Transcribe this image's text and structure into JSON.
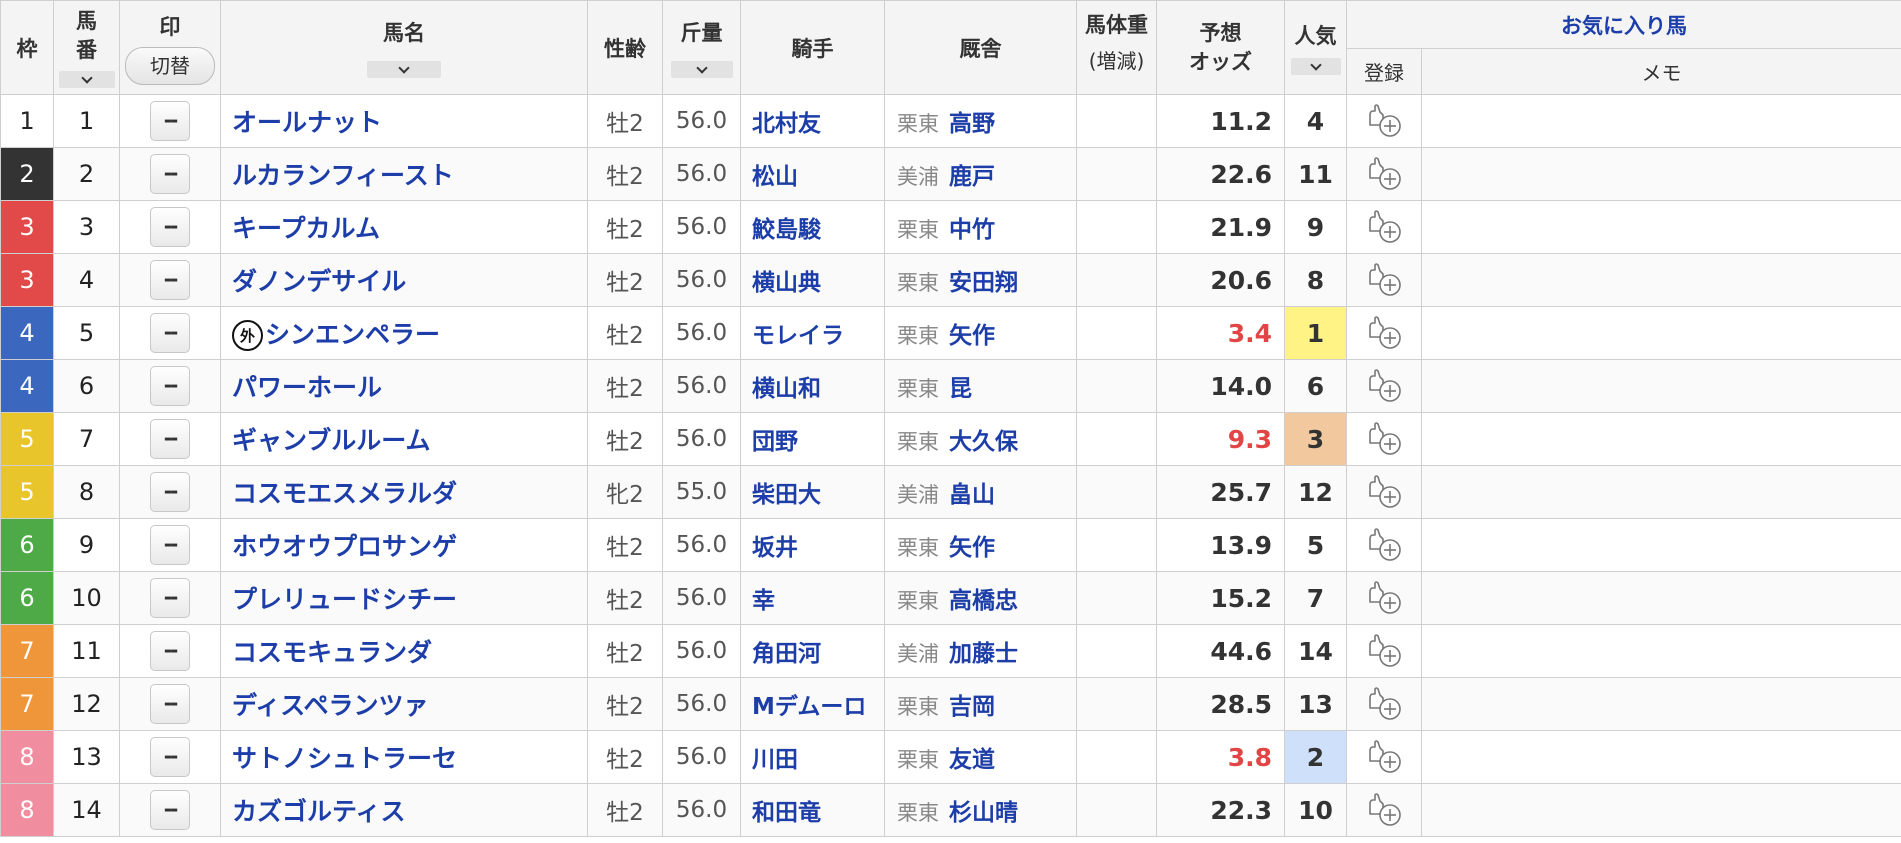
{
  "headers": {
    "waku": "枠",
    "umaban_1": "馬",
    "umaban_2": "番",
    "mark": "印",
    "mark_switch": "切替",
    "horse": "馬名",
    "sex_age": "性齢",
    "weight": "斤量",
    "jockey": "騎手",
    "stable": "厩舎",
    "body_weight": "馬体重",
    "body_weight_sub": "(増減)",
    "odds_1": "予想",
    "odds_2": "オッズ",
    "popularity": "人気",
    "favorite": "お気に入り馬",
    "register": "登録",
    "memo": "メモ"
  },
  "mark_placeholder": "--",
  "waku_colors": {
    "1": {
      "bg": "#ffffff",
      "fg": "#222222"
    },
    "2": {
      "bg": "#333333",
      "fg": "#ffffff"
    },
    "3": {
      "bg": "#e24a4a",
      "fg": "#ffffff"
    },
    "4": {
      "bg": "#3c67bf",
      "fg": "#ffffff"
    },
    "5": {
      "bg": "#e8c52a",
      "fg": "#ffffff"
    },
    "6": {
      "bg": "#4eaa46",
      "fg": "#ffffff"
    },
    "7": {
      "bg": "#ef963a",
      "fg": "#ffffff"
    },
    "8": {
      "bg": "#f08ea0",
      "fg": "#ffffff"
    }
  },
  "rows": [
    {
      "waku": "1",
      "umaban": "1",
      "name": "オールナット",
      "gaikoku": "",
      "sex": "牡2",
      "weight": "56.0",
      "jockey": "北村友",
      "region": "栗東",
      "trainer": "高野",
      "body_weight": "",
      "odds": "11.2",
      "odds_hot": false,
      "pop": "4",
      "pop_bg": ""
    },
    {
      "waku": "2",
      "umaban": "2",
      "name": "ルカランフィースト",
      "gaikoku": "",
      "sex": "牡2",
      "weight": "56.0",
      "jockey": "松山",
      "region": "美浦",
      "trainer": "鹿戸",
      "body_weight": "",
      "odds": "22.6",
      "odds_hot": false,
      "pop": "11",
      "pop_bg": ""
    },
    {
      "waku": "3",
      "umaban": "3",
      "name": "キープカルム",
      "gaikoku": "",
      "sex": "牡2",
      "weight": "56.0",
      "jockey": "鮫島駿",
      "region": "栗東",
      "trainer": "中竹",
      "body_weight": "",
      "odds": "21.9",
      "odds_hot": false,
      "pop": "9",
      "pop_bg": ""
    },
    {
      "waku": "3",
      "umaban": "4",
      "name": "ダノンデサイル",
      "gaikoku": "",
      "sex": "牡2",
      "weight": "56.0",
      "jockey": "横山典",
      "region": "栗東",
      "trainer": "安田翔",
      "body_weight": "",
      "odds": "20.6",
      "odds_hot": false,
      "pop": "8",
      "pop_bg": ""
    },
    {
      "waku": "4",
      "umaban": "5",
      "name": "シンエンペラー",
      "gaikoku": "外",
      "sex": "牡2",
      "weight": "56.0",
      "jockey": "モレイラ",
      "region": "栗東",
      "trainer": "矢作",
      "body_weight": "",
      "odds": "3.4",
      "odds_hot": true,
      "pop": "1",
      "pop_bg": "#fff385"
    },
    {
      "waku": "4",
      "umaban": "6",
      "name": "パワーホール",
      "gaikoku": "",
      "sex": "牡2",
      "weight": "56.0",
      "jockey": "横山和",
      "region": "栗東",
      "trainer": "昆",
      "body_weight": "",
      "odds": "14.0",
      "odds_hot": false,
      "pop": "6",
      "pop_bg": ""
    },
    {
      "waku": "5",
      "umaban": "7",
      "name": "ギャンブルルーム",
      "gaikoku": "",
      "sex": "牡2",
      "weight": "56.0",
      "jockey": "団野",
      "region": "栗東",
      "trainer": "大久保",
      "body_weight": "",
      "odds": "9.3",
      "odds_hot": true,
      "pop": "3",
      "pop_bg": "#f2c99e"
    },
    {
      "waku": "5",
      "umaban": "8",
      "name": "コスモエスメラルダ",
      "gaikoku": "",
      "sex": "牝2",
      "weight": "55.0",
      "jockey": "柴田大",
      "region": "美浦",
      "trainer": "畠山",
      "body_weight": "",
      "odds": "25.7",
      "odds_hot": false,
      "pop": "12",
      "pop_bg": ""
    },
    {
      "waku": "6",
      "umaban": "9",
      "name": "ホウオウプロサンゲ",
      "gaikoku": "",
      "sex": "牡2",
      "weight": "56.0",
      "jockey": "坂井",
      "region": "栗東",
      "trainer": "矢作",
      "body_weight": "",
      "odds": "13.9",
      "odds_hot": false,
      "pop": "5",
      "pop_bg": ""
    },
    {
      "waku": "6",
      "umaban": "10",
      "name": "プレリュードシチー",
      "gaikoku": "",
      "sex": "牡2",
      "weight": "56.0",
      "jockey": "幸",
      "region": "栗東",
      "trainer": "高橋忠",
      "body_weight": "",
      "odds": "15.2",
      "odds_hot": false,
      "pop": "7",
      "pop_bg": ""
    },
    {
      "waku": "7",
      "umaban": "11",
      "name": "コスモキュランダ",
      "gaikoku": "",
      "sex": "牡2",
      "weight": "56.0",
      "jockey": "角田河",
      "region": "美浦",
      "trainer": "加藤士",
      "body_weight": "",
      "odds": "44.6",
      "odds_hot": false,
      "pop": "14",
      "pop_bg": ""
    },
    {
      "waku": "7",
      "umaban": "12",
      "name": "ディスペランツァ",
      "gaikoku": "",
      "sex": "牡2",
      "weight": "56.0",
      "jockey": "Mデムーロ",
      "region": "栗東",
      "trainer": "吉岡",
      "body_weight": "",
      "odds": "28.5",
      "odds_hot": false,
      "pop": "13",
      "pop_bg": ""
    },
    {
      "waku": "8",
      "umaban": "13",
      "name": "サトノシュトラーセ",
      "gaikoku": "",
      "sex": "牡2",
      "weight": "56.0",
      "jockey": "川田",
      "region": "栗東",
      "trainer": "友道",
      "body_weight": "",
      "odds": "3.8",
      "odds_hot": true,
      "pop": "2",
      "pop_bg": "#cfe0fb"
    },
    {
      "waku": "8",
      "umaban": "14",
      "name": "カズゴルティス",
      "gaikoku": "",
      "sex": "牡2",
      "weight": "56.0",
      "jockey": "和田竜",
      "region": "栗東",
      "trainer": "杉山晴",
      "body_weight": "",
      "odds": "22.3",
      "odds_hot": false,
      "pop": "10",
      "pop_bg": ""
    }
  ]
}
